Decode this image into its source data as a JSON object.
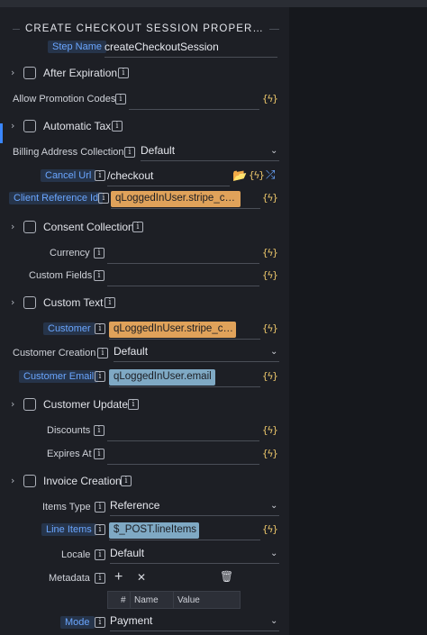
{
  "section": {
    "title": "CREATE CHECKOUT SESSION PROPER…"
  },
  "fields": {
    "step_name": {
      "label": "Step Name",
      "value": "createCheckoutSession"
    },
    "after_expiration": {
      "label": "After Expiration"
    },
    "allow_promotion_codes": {
      "label": "Allow Promotion Codes",
      "value": ""
    },
    "automatic_tax": {
      "label": "Automatic Tax"
    },
    "billing_address_collection": {
      "label": "Billing Address Collection",
      "value": "Default"
    },
    "cancel_url": {
      "label": "Cancel Url",
      "value": "/checkout"
    },
    "client_reference_id": {
      "label": "Client Reference Id",
      "value": "qLoggedInUser.stripe_c…"
    },
    "consent_collection": {
      "label": "Consent Collection"
    },
    "currency": {
      "label": "Currency",
      "value": ""
    },
    "custom_fields": {
      "label": "Custom Fields",
      "value": ""
    },
    "custom_text": {
      "label": "Custom Text"
    },
    "customer": {
      "label": "Customer",
      "value": "qLoggedInUser.stripe_c…"
    },
    "customer_creation": {
      "label": "Customer Creation",
      "value": "Default"
    },
    "customer_email": {
      "label": "Customer Email",
      "value": "qLoggedInUser.email"
    },
    "customer_update": {
      "label": "Customer Update"
    },
    "discounts": {
      "label": "Discounts",
      "value": ""
    },
    "expires_at": {
      "label": "Expires At",
      "value": ""
    },
    "invoice_creation": {
      "label": "Invoice Creation"
    },
    "items_type": {
      "label": "Items Type",
      "value": "Reference"
    },
    "line_items": {
      "label": "Line Items",
      "value": "$_POST.lineItems"
    },
    "locale": {
      "label": "Locale",
      "value": "Default"
    },
    "metadata": {
      "label": "Metadata",
      "columns": [
        "#",
        "Name",
        "Value"
      ]
    },
    "mode": {
      "label": "Mode",
      "value": "Payment"
    }
  },
  "icons": {
    "info": "i",
    "flash_expression": "{ϟ}",
    "chevron": "›",
    "dropdown": "⌄",
    "plus": "+",
    "close": "✕",
    "trash": "🗑",
    "folder": "📂",
    "shuffle": "⤮"
  },
  "colors": {
    "background": "#1d1f25",
    "chip_orange": "#e0a25a",
    "chip_blue": "#7fa9c4",
    "label_accent": "#6aa6ff",
    "expression_icon": "#e9c46a"
  }
}
